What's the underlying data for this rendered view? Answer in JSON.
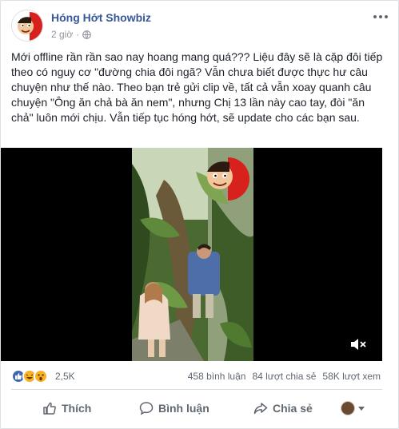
{
  "post": {
    "page_name": "Hóng Hớt Showbiz",
    "time": "2 giờ",
    "separator": "·",
    "privacy_icon": "globe-icon",
    "text": "Mới offline rần rần sao nay hoang mang quá??? Liệu đây sẽ là cặp đôi tiếp theo có nguy cơ \"đường chia đôi ngã? Vẫn chưa biết được thực hư câu chuyện như thế nào. Theo bạn trẻ gửi clip về, tất cả vẫn xoay quanh câu chuyện \"Ông ăn chả bà ăn nem\", nhưng Chị 13 lần này cao tay, đòi \"ăn chả\" luôn mới chịu. Vẫn tiếp tục hóng hớt, sẽ update cho các bạn sau."
  },
  "reactions": {
    "icons": [
      "like-icon",
      "haha-icon",
      "wow-icon"
    ],
    "count": "2,5K"
  },
  "stats": {
    "comments": "458 bình luận",
    "shares": "84 lượt chia sẻ",
    "views": "58K lượt xem"
  },
  "actions": {
    "like": "Thích",
    "comment": "Bình luận",
    "share": "Chia sẻ"
  },
  "colors": {
    "link": "#365899",
    "muted": "#90949c",
    "like_blue": "#4267b2",
    "haha_yellow": "#f7b125"
  }
}
